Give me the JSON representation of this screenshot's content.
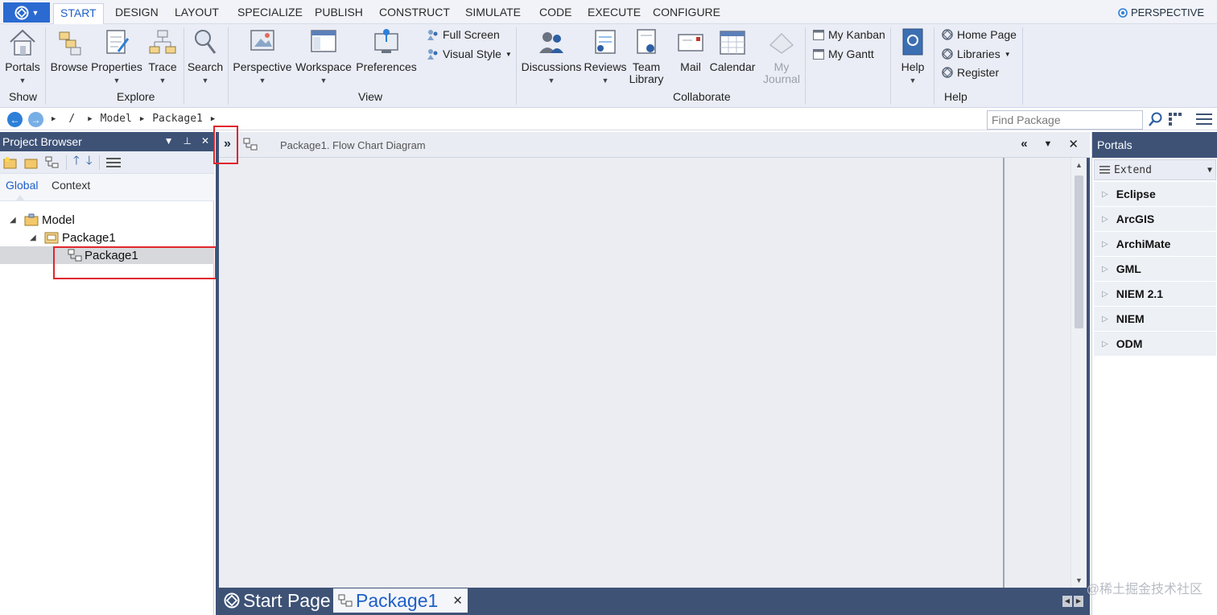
{
  "menu": {
    "tabs": [
      "START",
      "DESIGN",
      "LAYOUT",
      "SPECIALIZE",
      "PUBLISH",
      "CONSTRUCT",
      "SIMULATE",
      "CODE",
      "EXECUTE",
      "CONFIGURE"
    ],
    "active_tab": "START",
    "perspective": "PERSPECTIVE"
  },
  "ribbon": {
    "show": {
      "portals": "Portals",
      "label": "Show"
    },
    "explore": {
      "browse": "Browse",
      "properties": "Properties",
      "trace": "Trace",
      "search": "Search",
      "label": "Explore"
    },
    "view": {
      "perspective": "Perspective",
      "workspace": "Workspace",
      "preferences": "Preferences",
      "full_screen": "Full Screen",
      "visual_style": "Visual Style",
      "label": "View"
    },
    "collaborate": {
      "discussions": "Discussions",
      "reviews": "Reviews",
      "team": "Team",
      "library": "Library",
      "mail": "Mail",
      "calendar": "Calendar",
      "my": "My",
      "journal": "Journal",
      "my_kanban": "My Kanban",
      "my_gantt": "My Gantt",
      "label": "Collaborate"
    },
    "help": {
      "help": "Help",
      "home_page": "Home Page",
      "libraries": "Libraries",
      "register": "Register",
      "label": "Help"
    }
  },
  "navbar": {
    "crumbs": [
      "/",
      "Model",
      "Package1"
    ],
    "find_placeholder": "Find Package"
  },
  "project_browser": {
    "title": "Project Browser",
    "tabs": [
      "Global",
      "Context"
    ],
    "tree": [
      {
        "label": "Model"
      },
      {
        "label": "Package1"
      },
      {
        "label": "Package1"
      }
    ]
  },
  "diagram": {
    "title": "Package1.  Flow Chart Diagram",
    "bottom_tabs": [
      "Start Page",
      "Package1"
    ]
  },
  "portals": {
    "title": "Portals",
    "select_value": "Extend",
    "items": [
      "Eclipse",
      "ArcGIS",
      "ArchiMate",
      "GML",
      "NIEM 2.1",
      "NIEM",
      "ODM"
    ]
  },
  "watermark": "@稀土掘金技术社区",
  "colors": {
    "accent": "#1e5fc7",
    "panel_header": "#3e5276",
    "highlight": "#e0262d"
  }
}
